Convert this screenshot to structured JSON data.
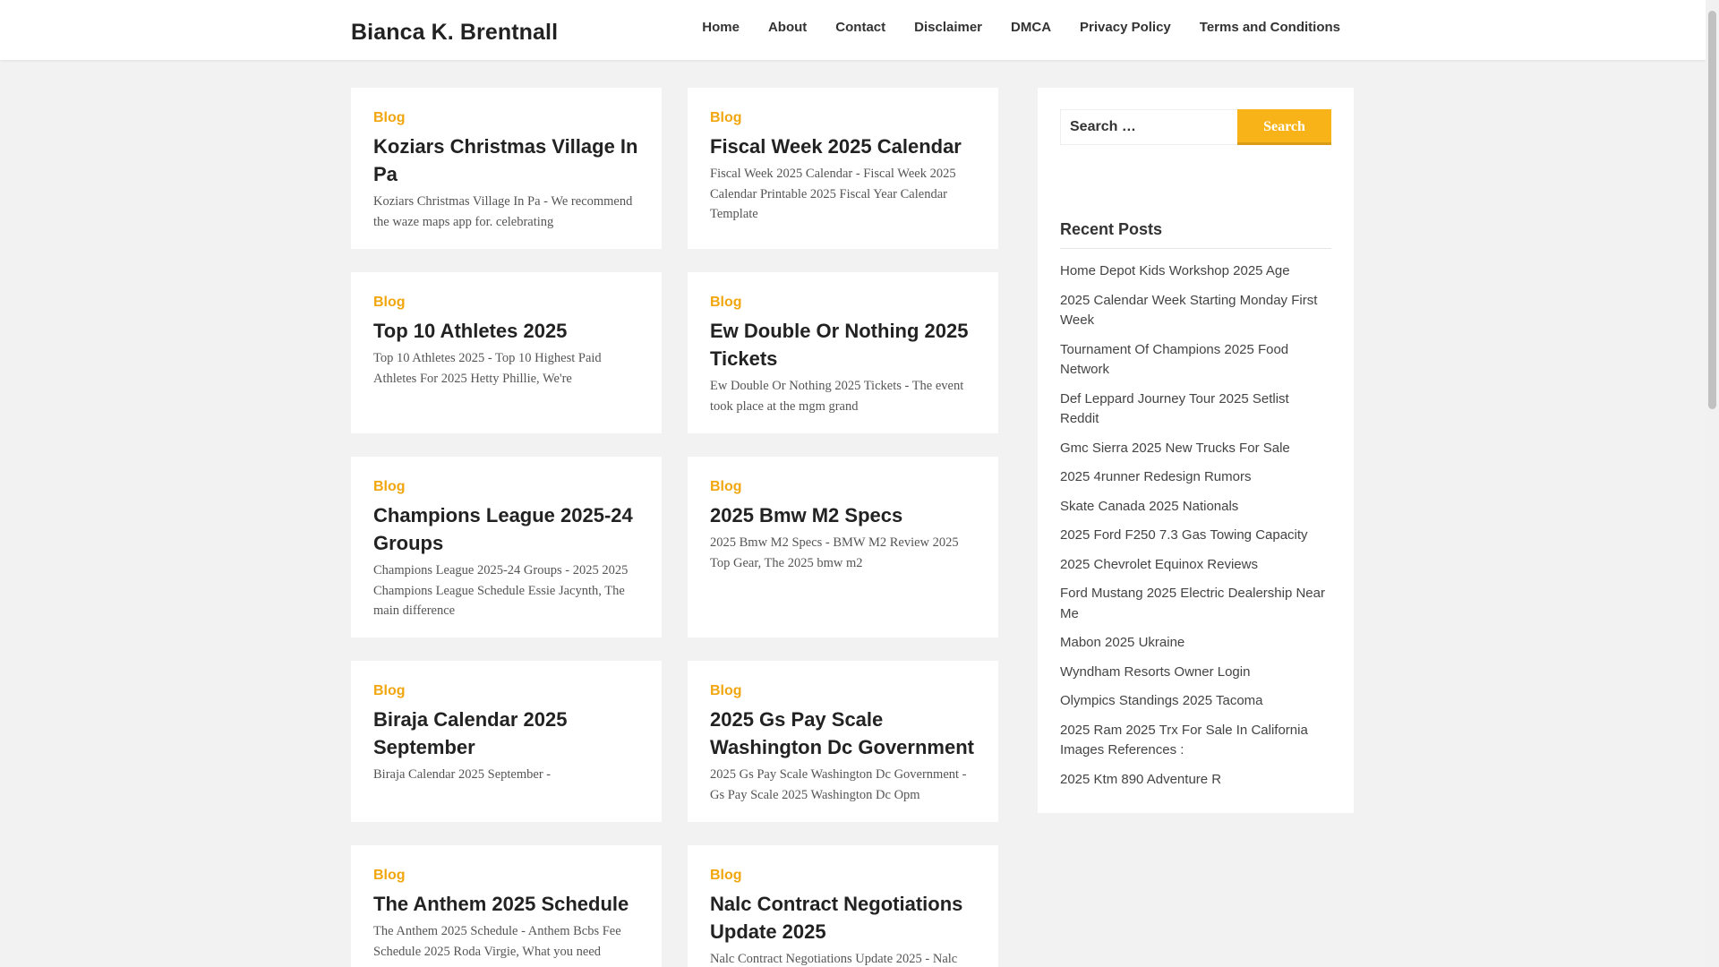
{
  "site": {
    "title": "Bianca K. Brentnall"
  },
  "nav": [
    {
      "label": "Home"
    },
    {
      "label": "About"
    },
    {
      "label": "Contact"
    },
    {
      "label": "Disclaimer"
    },
    {
      "label": "DMCA"
    },
    {
      "label": "Privacy Policy"
    },
    {
      "label": "Terms and Conditions"
    }
  ],
  "posts": [
    {
      "category": "Blog",
      "title": "Koziars Christmas Village In Pa",
      "excerpt": "Koziars Christmas Village In Pa - We recommend the waze maps app for. celebrating"
    },
    {
      "category": "Blog",
      "title": "Fiscal Week 2025 Calendar",
      "excerpt": "Fiscal Week 2025 Calendar - Fiscal Week 2025 Calendar Printable 2025 Fiscal Year Calendar Template"
    },
    {
      "category": "Blog",
      "title": "Top 10 Athletes 2025",
      "excerpt": "Top 10 Athletes 2025 - Top 10 Highest Paid Athletes For 2025 Hetty Phillie, We're"
    },
    {
      "category": "Blog",
      "title": "Ew Double Or Nothing 2025 Tickets",
      "excerpt": "Ew Double Or Nothing 2025 Tickets - The event took place at the mgm grand"
    },
    {
      "category": "Blog",
      "title": "Champions League 2025-24 Groups",
      "excerpt": "Champions League 2025-24 Groups - 2025 2025 Champions League Schedule Essie Jacynth, The main difference"
    },
    {
      "category": "Blog",
      "title": "2025 Bmw M2 Specs",
      "excerpt": "2025 Bmw M2 Specs - BMW M2 Review 2025 Top Gear, The 2025 bmw m2"
    },
    {
      "category": "Blog",
      "title": "Biraja Calendar 2025 September",
      "excerpt": "Biraja Calendar 2025 September -"
    },
    {
      "category": "Blog",
      "title": "2025 Gs Pay Scale Washington Dc Government",
      "excerpt": "2025 Gs Pay Scale Washington Dc Government - Gs Pay Scale 2025 Washington Dc Opm"
    },
    {
      "category": "Blog",
      "title": "The Anthem 2025 Schedule",
      "excerpt": "The Anthem 2025 Schedule - Anthem Bcbs Fee Schedule 2025 Roda Virgie, What you need"
    },
    {
      "category": "Blog",
      "title": "Nalc Contract Negotiations Update 2025",
      "excerpt": "Nalc Contract Negotiations Update 2025 - Nalc"
    }
  ],
  "sidebar": {
    "search": {
      "placeholder": "Search …",
      "button_label": "Search"
    },
    "recent_title": "Recent Posts",
    "recent_posts": [
      "Home Depot Kids Workshop 2025 Age",
      "2025 Calendar Week Starting Monday First Week",
      "Tournament Of Champions 2025 Food Network",
      "Def Leppard Journey Tour 2025 Setlist Reddit",
      "Gmc Sierra 2025 New Trucks For Sale",
      "2025 4runner Redesign Rumors",
      "Skate Canada 2025 Nationals",
      "2025 Ford F250 7.3 Gas Towing Capacity",
      "2025 Chevrolet Equinox Reviews",
      "Ford Mustang 2025 Electric Dealership Near Me",
      "Mabon 2025 Ukraine",
      "Wyndham Resorts Owner Login",
      "Olympics Standings 2025 Tacoma",
      "2025 Ram 2025 Trx For Sale In California Images References :",
      "2025 Ktm 890 Adventure R"
    ]
  },
  "colors": {
    "accent": "#f1a60e",
    "button": "#f7b318",
    "background": "#f2f2f2"
  }
}
